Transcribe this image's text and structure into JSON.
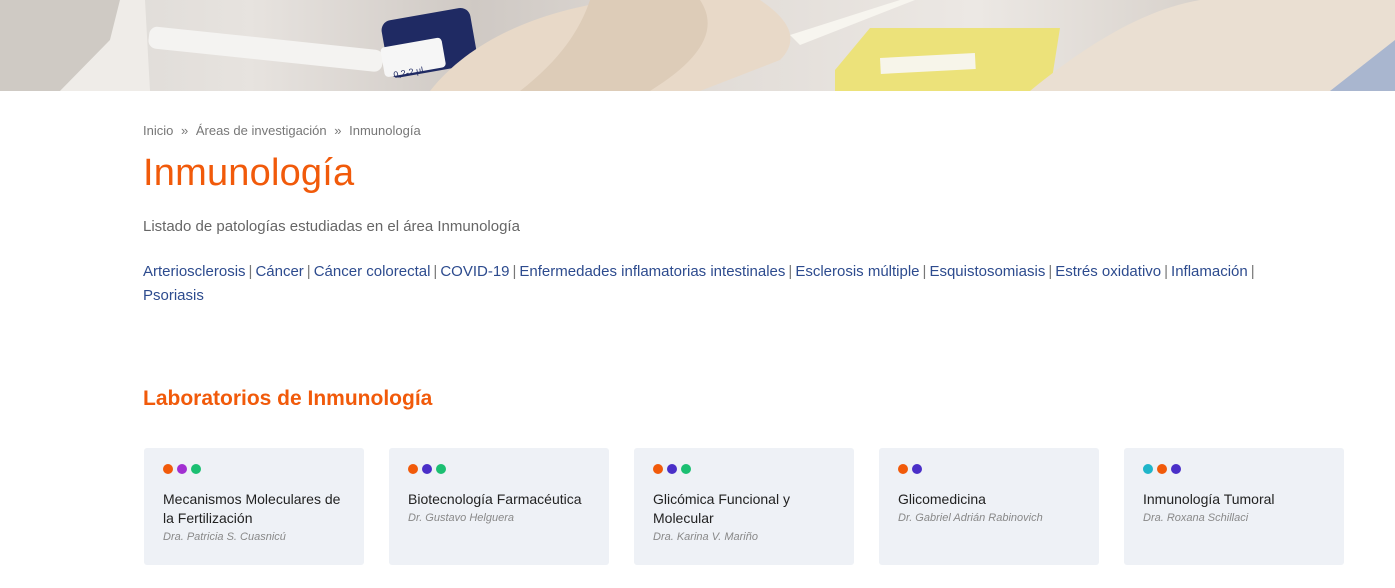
{
  "breadcrumb": {
    "home": "Inicio",
    "sep1": "»",
    "areas": "Áreas de investigación",
    "sep2": "»",
    "current": "Inmunología"
  },
  "page": {
    "title": "Inmunología",
    "subtitle": "Listado de patologías estudiadas en el área Inmunología"
  },
  "pathologies": [
    "Arteriosclerosis",
    "Cáncer",
    "Cáncer colorectal",
    "COVID-19",
    "Enfermedades inflamatorias intestinales",
    "Esclerosis múltiple",
    "Esquistosomiasis",
    "Estrés oxidativo",
    "Inflamación",
    "Psoriasis"
  ],
  "pathology_separator": "|",
  "labs": {
    "title": "Laboratorios de Inmunología",
    "cards": [
      {
        "title": "Mecanismos Moleculares de la Fertilización",
        "person": "Dra. Patricia S. Cuasnicú",
        "dots": [
          "#f15a0a",
          "#a12fd1",
          "#1bbf72"
        ]
      },
      {
        "title": "Biotecnología Farmacéutica",
        "person": "Dr. Gustavo Helguera",
        "dots": [
          "#f15a0a",
          "#4a2fc8",
          "#1bbf72"
        ]
      },
      {
        "title": "Glicómica Funcional y Molecular",
        "person": "Dra. Karina V. Mariño",
        "dots": [
          "#f15a0a",
          "#4a2fc8",
          "#1bbf72"
        ]
      },
      {
        "title": "Glicomedicina",
        "person": "Dr. Gabriel Adrián Rabinovich",
        "dots": [
          "#f15a0a",
          "#4a2fc8"
        ]
      },
      {
        "title": "Inmunología Tumoral",
        "person": "Dra. Roxana Schillaci",
        "dots": [
          "#1fb5c9",
          "#f15a0a",
          "#4a2fc8"
        ]
      }
    ]
  },
  "hero": {
    "pipette_label": "0,2-2 µl"
  },
  "colors": {
    "accent": "#f15a0a",
    "link": "#2d4b8e"
  }
}
